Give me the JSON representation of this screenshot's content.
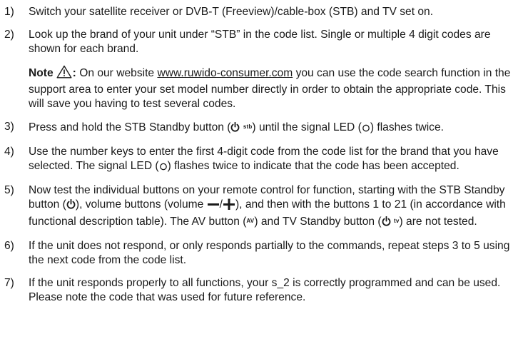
{
  "steps": [
    {
      "num": "1)",
      "text": "Switch your satellite receiver or DVB-T (Freeview)/cable-box (STB) and TV set on."
    },
    {
      "num": "2)",
      "text": "Look up the brand of your unit under “STB” in the code list. Single or multiple 4 digit codes are shown for each brand.",
      "note": {
        "label": "Note",
        "colon": ":",
        "before_link": "On our website",
        "link": "www.ruwido-consumer.com",
        "after_link": "you can use the code search function in the support area to enter your set model number directly in order to obtain the appropriate code. This will save you having to test several codes."
      }
    },
    {
      "num": "3)",
      "a": "Press and hold the STB Standby button (",
      "stb_tag": "stb",
      "b": ") until the signal LED (",
      "c": ") flashes twice."
    },
    {
      "num": "4)",
      "a": "Use the number keys to enter the first 4-digit code from the code list for the brand that you have selected. The signal LED (",
      "b": ") flashes twice to indicate that the code has been accepted."
    },
    {
      "num": "5)",
      "a": "Now test the individual buttons on your remote control for function, starting with the STB Standby button (",
      "b": "), volume buttons (volume ",
      "slash": "/",
      "c": "), and then with the buttons 1 to 21 (in accordance with functional description table). The AV button (",
      "av_tag": "AV",
      "d": ") and TV Standby button (",
      "tv_tag": "tv",
      "e": ") are not tested."
    },
    {
      "num": "6)",
      "text": "If the unit does not respond, or only responds partially to the commands, repeat steps 3 to 5 using the next code from the code list."
    },
    {
      "num": "7)",
      "text": "If the unit responds properly to all functions, your s_2 is correctly programmed and can be used. Please note the code that was used for future reference."
    }
  ],
  "icons": {
    "warning": "warning-triangle-icon",
    "power": "power-icon",
    "led": "led-icon",
    "minus": "minus-icon",
    "plus": "plus-icon"
  }
}
